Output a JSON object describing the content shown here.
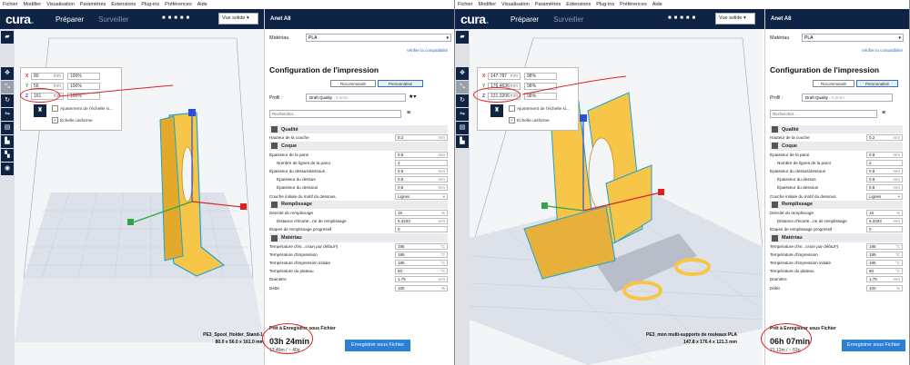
{
  "menu": [
    "Fichier",
    "Modifier",
    "Visualisation",
    "Paramètres",
    "Extensions",
    "Plug-ins",
    "Préférences",
    "Aide"
  ],
  "brand": "cura",
  "tabs": {
    "prepare": "Préparer",
    "monitor": "Surveiller"
  },
  "view_mode": "Vue solide",
  "printer": "Anet A8",
  "material_label": "Matériau",
  "material_value": "PLA",
  "verify_link": "Vérifier la compatibilité",
  "config_title": "Configuration de l'impression",
  "mode_recommended": "Recommandé",
  "mode_custom": "Personnalisé",
  "profile_label": "Profil :",
  "profile_value": "Draft Quality",
  "profile_suffix": "- 0.2mm",
  "search_placeholder": "Rechercher...",
  "uniform_scale": "Échelle uniforme",
  "snap_scale": "Ajustement de l'échelle si...",
  "ready": "Prêt à Enregistrer sous Fichier",
  "save_button": "Enregistrer sous Fichier",
  "left": {
    "scale": [
      {
        "axis": "X",
        "mm": "80",
        "pct": "100"
      },
      {
        "axis": "Y",
        "mm": "56",
        "pct": "100"
      },
      {
        "axis": "Z",
        "mm": "161",
        "pct": "100"
      }
    ],
    "file_name": "PE3_Spool_Holder_Stand-1",
    "dimensions": "80.0 x 56.0 x 161.0 mm",
    "print_time": "03h 24min",
    "material_estimate": "13.49m / ~ 40g",
    "settings": {
      "quality_cat": "Qualité",
      "layer_height": {
        "label": "Hauteur de la couche",
        "value": "0.2"
      },
      "shell_cat": "Coque",
      "wall_thickness": {
        "label": "Épaisseur de la paroi",
        "value": "0.8"
      },
      "wall_lines": {
        "label": "Nombre de lignes de la paroi",
        "value": "2"
      },
      "topbottom": {
        "label": "Épaisseur du dessus/dessous",
        "value": "0.8"
      },
      "top": {
        "label": "Épaisseur du dessus",
        "value": "0.8"
      },
      "bottom": {
        "label": "Épaisseur du dessous",
        "value": "0.8"
      },
      "initial_pattern": {
        "label": "Couche initiale du motif du dessous.",
        "value": "Lignes"
      },
      "infill_cat": "Remplissage",
      "infill_density": {
        "label": "Densité du remplissage",
        "value": "15"
      },
      "infill_dist": {
        "label": "Distance d'écarte...ne de remplissage",
        "value": "5.3333"
      },
      "infill_steps": {
        "label": "Étapes de remplissage progressif",
        "value": "0"
      },
      "material_cat": "Matériau",
      "temp_default": {
        "label": "Température d'im...ssion par défaut*)",
        "value": "195"
      },
      "temp_print": {
        "label": "Température d'impression",
        "value": "195"
      },
      "temp_initial": {
        "label": "Température d'impression initiale",
        "value": "185"
      },
      "temp_bed": {
        "label": "Température du plateau",
        "value": "60"
      },
      "diameter": {
        "label": "Diamètre",
        "value": "1.75"
      },
      "flow": {
        "label": "Débit",
        "value": "100"
      }
    }
  },
  "right": {
    "scale": [
      {
        "axis": "X",
        "mm": "147.787",
        "pct": "98"
      },
      {
        "axis": "Y",
        "mm": "176.4636",
        "pct": "98"
      },
      {
        "axis": "Z",
        "mm": "121.3206",
        "pct": "98"
      }
    ],
    "file_name": "PE3_mon multi-supports de rouleaux PLA",
    "dimensions": "147.8 x 176.4 x 121.3 mm",
    "print_time": "06h 07min",
    "material_estimate": "21.12m / ~ 63g"
  },
  "units": {
    "mm": "mm",
    "pct": "%",
    "deg": "°C"
  },
  "icons": [
    "open-file-icon",
    "move-icon",
    "scale-icon",
    "rotate-icon",
    "mirror-icon",
    "per-model-settings-icon",
    "support-blocker-icon",
    "more-icon",
    "eye-icon",
    "settings-icon",
    "star-icon",
    "chevron-down-icon",
    "link-icon",
    "reset-icon"
  ],
  "colors": {
    "brand_dark": "#0f2344",
    "accent": "#2c7fd6",
    "model": "#f7c548",
    "model_outline": "#1aa3d6",
    "annotation": "#dd2222"
  }
}
